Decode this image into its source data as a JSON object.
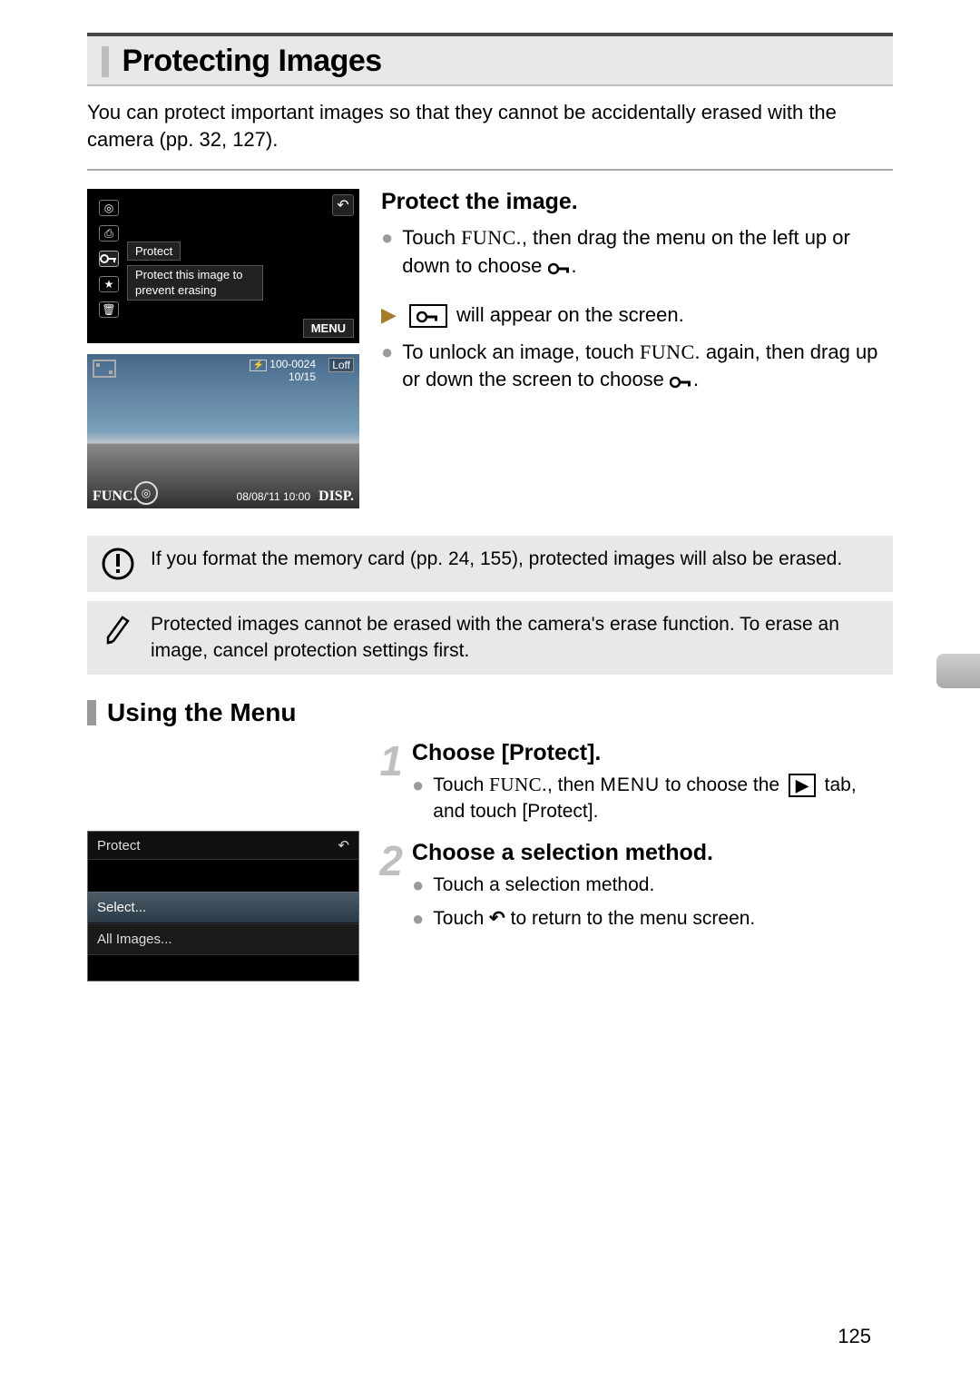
{
  "page_number": "125",
  "title": "Protecting Images",
  "intro": "You can protect important images so that they cannot be accidentally erased with the camera (pp. 32, 127).",
  "screen1": {
    "label": "Protect",
    "hint": "Protect this image to prevent erasing",
    "menu": "MENU"
  },
  "screen2": {
    "folder": "100-0024",
    "count": "10/15",
    "loff": "Loff",
    "func": "FUNC.",
    "disp": "DISP.",
    "datetime": "08/08/'11   10:00"
  },
  "protect": {
    "heading": "Protect the image.",
    "b1a": "Touch ",
    "b1_func": "FUNC.",
    "b1b": ", then drag the menu on the left up or down to choose ",
    "b1c": ".",
    "r1a": " will appear on the screen.",
    "b2a": "To unlock an image, touch ",
    "b2_func": "FUNC.",
    "b2b": " again, then drag up or down the screen to choose ",
    "b2c": "."
  },
  "note1": "If you format the memory card (pp. 24, 155), protected images will also be erased.",
  "note2": "Protected images cannot be erased with the camera's erase function. To erase an image, cancel protection settings first.",
  "using_menu_heading": "Using the Menu",
  "step1": {
    "num": "1",
    "heading": "Choose [Protect].",
    "a": "Touch ",
    "func": "FUNC.",
    "b": ", then ",
    "menu": "MENU",
    "c": " to choose the ",
    "d": " tab, and touch [Protect]."
  },
  "step2": {
    "num": "2",
    "heading": "Choose a selection method.",
    "b1": "Touch a selection method.",
    "b2a": "Touch ",
    "b2b": " to return to the menu screen."
  },
  "menuscreen": {
    "title": "Protect",
    "row1": "Select...",
    "row2": "All Images..."
  }
}
